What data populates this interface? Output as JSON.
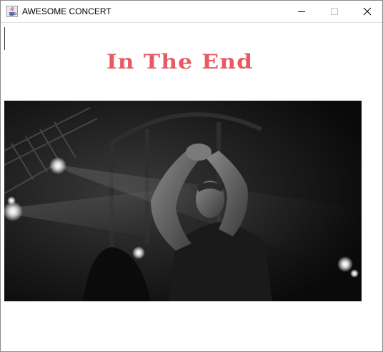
{
  "window": {
    "title": "AWESOME CONCERT",
    "app_icon": "java-cup-icon",
    "controls": {
      "minimize_icon": "minimize-icon",
      "maximize_icon": "maximize-icon",
      "close_icon": "close-icon"
    }
  },
  "content": {
    "song_title": "In The End",
    "song_title_color": "#e85a63",
    "photo": {
      "description_icon": "concert-photo"
    }
  }
}
